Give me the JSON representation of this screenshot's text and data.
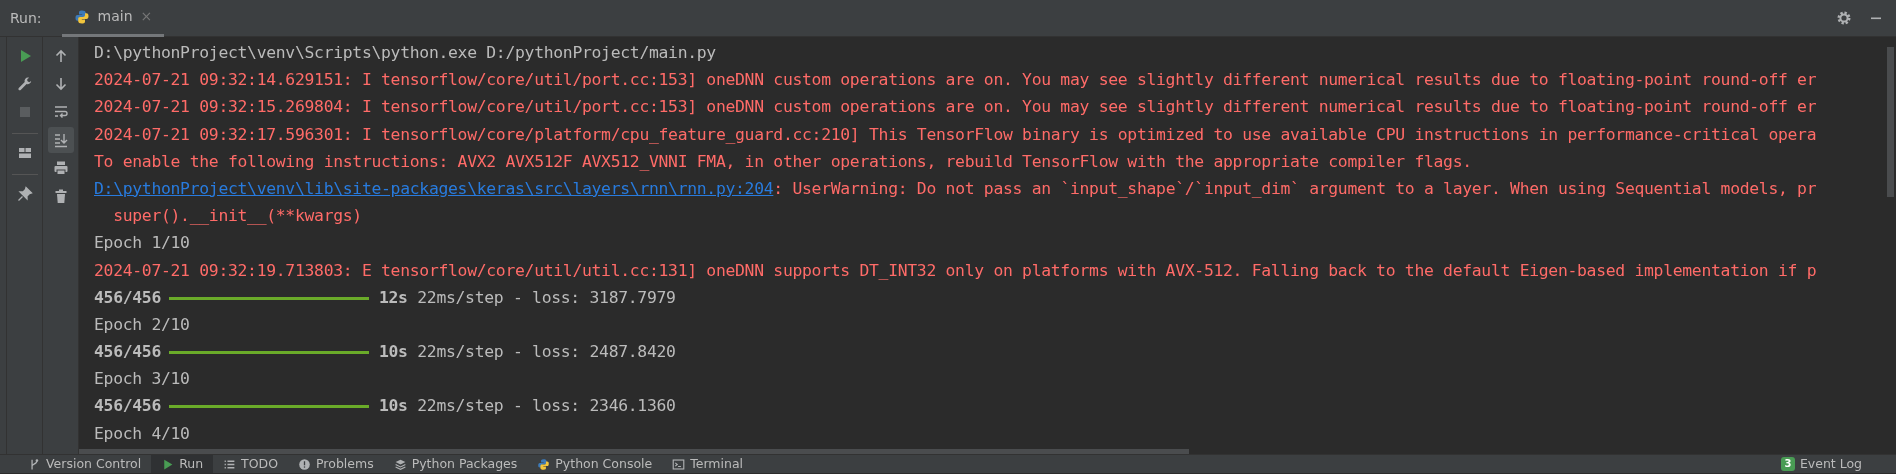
{
  "run_panel": {
    "label": "Run:",
    "tabs": [
      {
        "kind": "python",
        "label": "main",
        "close": "×",
        "selected": true
      }
    ],
    "actions": [
      {
        "kind": "gear"
      },
      {
        "kind": "minimize"
      }
    ]
  },
  "left_tools": [
    {
      "kind": "play",
      "disabled": false
    },
    {
      "kind": "wrench",
      "disabled": false
    },
    {
      "kind": "stop",
      "disabled": true
    },
    {
      "kind": "separator"
    },
    {
      "kind": "layout",
      "disabled": false
    },
    {
      "kind": "separator"
    },
    {
      "kind": "pin",
      "disabled": false
    }
  ],
  "console_tools": [
    {
      "kind": "up",
      "selected": false
    },
    {
      "kind": "down",
      "selected": false
    },
    {
      "kind": "softwrap",
      "selected": false
    },
    {
      "kind": "scrollend",
      "selected": true
    },
    {
      "kind": "print",
      "selected": false
    },
    {
      "kind": "trash",
      "selected": false
    }
  ],
  "console": {
    "lines": [
      {
        "kind": "command",
        "text": "D:\\pythonProject\\venv\\Scripts\\python.exe D:/pythonProject/main.py"
      },
      {
        "kind": "error",
        "text": "2024-07-21 09:32:14.629151: I tensorflow/core/util/port.cc:153] oneDNN custom operations are on. You may see slightly different numerical results due to floating-point round-off er"
      },
      {
        "kind": "error",
        "text": "2024-07-21 09:32:15.269804: I tensorflow/core/util/port.cc:153] oneDNN custom operations are on. You may see slightly different numerical results due to floating-point round-off er"
      },
      {
        "kind": "error",
        "text": "2024-07-21 09:32:17.596301: I tensorflow/core/platform/cpu_feature_guard.cc:210] This TensorFlow binary is optimized to use available CPU instructions in performance-critical opera"
      },
      {
        "kind": "error",
        "text": "To enable the following instructions: AVX2 AVX512F AVX512_VNNI FMA, in other operations, rebuild TensorFlow with the appropriate compiler flags."
      },
      {
        "kind": "link_error",
        "link": "D:\\pythonProject\\venv\\lib\\site-packages\\keras\\src\\layers\\rnn\\rnn.py:204",
        "text": ": UserWarning: Do not pass an `input_shape`/`input_dim` argument to a layer. When using Sequential models, pr"
      },
      {
        "kind": "error",
        "text": "  super().__init__(**kwargs)"
      },
      {
        "kind": "output",
        "text": "Epoch 1/10"
      },
      {
        "kind": "error",
        "text": "2024-07-21 09:32:19.713803: E tensorflow/core/util/util.cc:131] oneDNN supports DT_INT32 only on platforms with AVX-512. Falling back to the default Eigen-based implementation if p"
      },
      {
        "kind": "progress",
        "steps": "456/456",
        "level": 1,
        "time": "12s",
        "text": "22ms/step - loss: 3187.7979"
      },
      {
        "kind": "output",
        "text": "Epoch 2/10"
      },
      {
        "kind": "progress",
        "steps": "456/456",
        "level": 1,
        "time": "10s",
        "text": "22ms/step - loss: 2487.8420"
      },
      {
        "kind": "output",
        "text": "Epoch 3/10"
      },
      {
        "kind": "progress",
        "steps": "456/456",
        "level": 1,
        "time": "10s",
        "text": "22ms/step - loss: 2346.1360"
      },
      {
        "kind": "output",
        "text": "Epoch 4/10"
      }
    ]
  },
  "bottom_bar": {
    "tabs": [
      {
        "kind": "branch",
        "label": "Version Control",
        "selected": false
      },
      {
        "kind": "play",
        "label": "Run",
        "selected": true
      },
      {
        "kind": "list",
        "label": "TODO",
        "selected": false
      },
      {
        "kind": "problem",
        "label": "Problems",
        "selected": false
      },
      {
        "kind": "layers",
        "label": "Python Packages",
        "selected": false
      },
      {
        "kind": "python",
        "label": "Python Console",
        "selected": false
      },
      {
        "kind": "terminal",
        "label": "Terminal",
        "selected": false
      }
    ],
    "event_log": {
      "label": "Event Log",
      "badge": "3"
    }
  }
}
